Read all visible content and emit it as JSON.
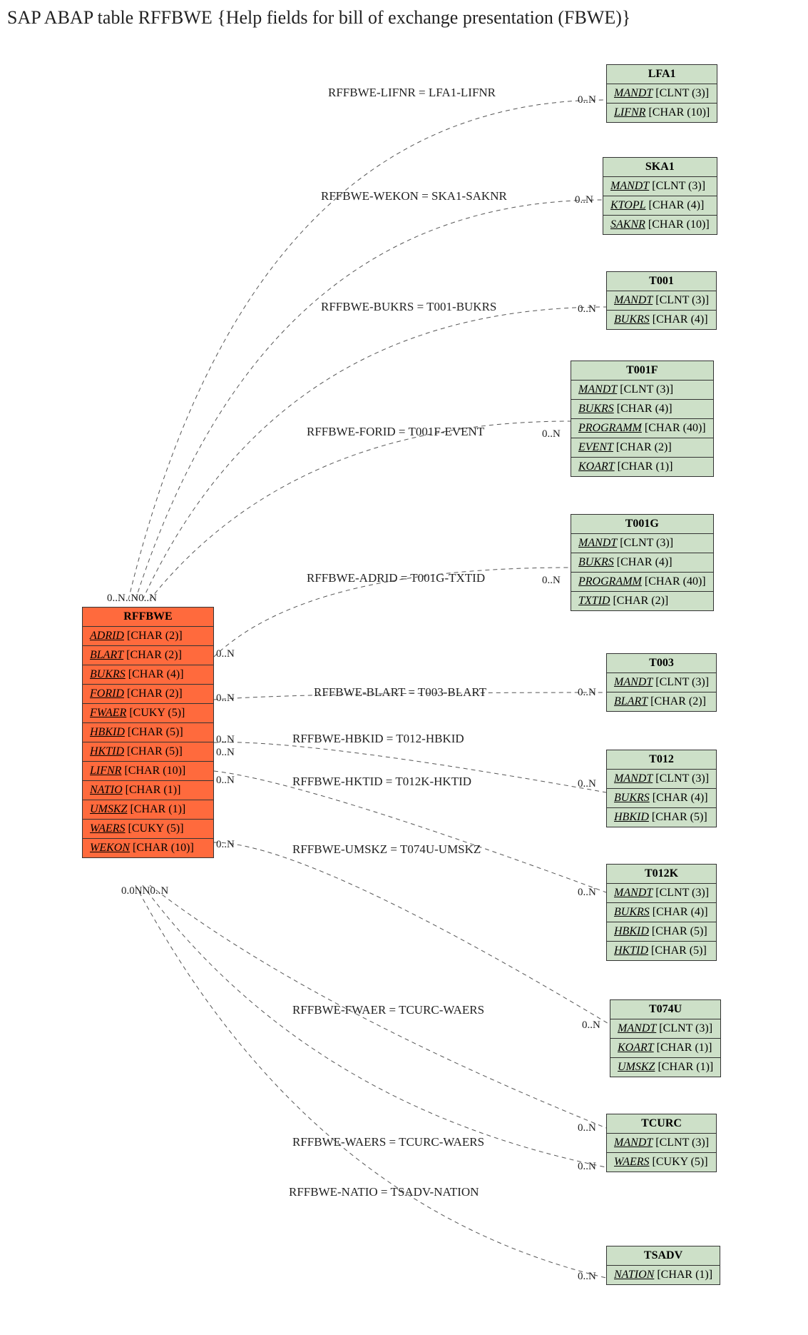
{
  "title": "SAP ABAP table RFFBWE {Help fields for bill of exchange presentation (FBWE)}",
  "main_entity": {
    "name": "RFFBWE",
    "fields": [
      {
        "name": "ADRID",
        "type": "[CHAR (2)]"
      },
      {
        "name": "BLART",
        "type": "[CHAR (2)]"
      },
      {
        "name": "BUKRS",
        "type": "[CHAR (4)]"
      },
      {
        "name": "FORID",
        "type": "[CHAR (2)]"
      },
      {
        "name": "FWAER",
        "type": "[CUKY (5)]"
      },
      {
        "name": "HBKID",
        "type": "[CHAR (5)]"
      },
      {
        "name": "HKTID",
        "type": "[CHAR (5)]"
      },
      {
        "name": "LIFNR",
        "type": "[CHAR (10)]"
      },
      {
        "name": "NATIO",
        "type": "[CHAR (1)]"
      },
      {
        "name": "UMSKZ",
        "type": "[CHAR (1)]"
      },
      {
        "name": "WAERS",
        "type": "[CUKY (5)]"
      },
      {
        "name": "WEKON",
        "type": "[CHAR (10)]"
      }
    ]
  },
  "ref_entities": [
    {
      "name": "LFA1",
      "fields": [
        {
          "name": "MANDT",
          "type": "[CLNT (3)]"
        },
        {
          "name": "LIFNR",
          "type": "[CHAR (10)]"
        }
      ]
    },
    {
      "name": "SKA1",
      "fields": [
        {
          "name": "MANDT",
          "type": "[CLNT (3)]"
        },
        {
          "name": "KTOPL",
          "type": "[CHAR (4)]"
        },
        {
          "name": "SAKNR",
          "type": "[CHAR (10)]"
        }
      ]
    },
    {
      "name": "T001",
      "fields": [
        {
          "name": "MANDT",
          "type": "[CLNT (3)]"
        },
        {
          "name": "BUKRS",
          "type": "[CHAR (4)]"
        }
      ]
    },
    {
      "name": "T001F",
      "fields": [
        {
          "name": "MANDT",
          "type": "[CLNT (3)]"
        },
        {
          "name": "BUKRS",
          "type": "[CHAR (4)]"
        },
        {
          "name": "PROGRAMM",
          "type": "[CHAR (40)]"
        },
        {
          "name": "EVENT",
          "type": "[CHAR (2)]"
        },
        {
          "name": "KOART",
          "type": "[CHAR (1)]"
        }
      ]
    },
    {
      "name": "T001G",
      "fields": [
        {
          "name": "MANDT",
          "type": "[CLNT (3)]"
        },
        {
          "name": "BUKRS",
          "type": "[CHAR (4)]"
        },
        {
          "name": "PROGRAMM",
          "type": "[CHAR (40)]"
        },
        {
          "name": "TXTID",
          "type": "[CHAR (2)]"
        }
      ]
    },
    {
      "name": "T003",
      "fields": [
        {
          "name": "MANDT",
          "type": "[CLNT (3)]"
        },
        {
          "name": "BLART",
          "type": "[CHAR (2)]"
        }
      ]
    },
    {
      "name": "T012",
      "fields": [
        {
          "name": "MANDT",
          "type": "[CLNT (3)]"
        },
        {
          "name": "BUKRS",
          "type": "[CHAR (4)]"
        },
        {
          "name": "HBKID",
          "type": "[CHAR (5)]"
        }
      ]
    },
    {
      "name": "T012K",
      "fields": [
        {
          "name": "MANDT",
          "type": "[CLNT (3)]"
        },
        {
          "name": "BUKRS",
          "type": "[CHAR (4)]"
        },
        {
          "name": "HBKID",
          "type": "[CHAR (5)]"
        },
        {
          "name": "HKTID",
          "type": "[CHAR (5)]"
        }
      ]
    },
    {
      "name": "T074U",
      "fields": [
        {
          "name": "MANDT",
          "type": "[CLNT (3)]"
        },
        {
          "name": "KOART",
          "type": "[CHAR (1)]"
        },
        {
          "name": "UMSKZ",
          "type": "[CHAR (1)]"
        }
      ]
    },
    {
      "name": "TCURC",
      "fields": [
        {
          "name": "MANDT",
          "type": "[CLNT (3)]"
        },
        {
          "name": "WAERS",
          "type": "[CUKY (5)]"
        }
      ]
    },
    {
      "name": "TSADV",
      "fields": [
        {
          "name": "NATION",
          "type": "[CHAR (1)]"
        }
      ]
    }
  ],
  "relations": [
    {
      "label": "RFFBWE-LIFNR = LFA1-LIFNR"
    },
    {
      "label": "RFFBWE-WEKON = SKA1-SAKNR"
    },
    {
      "label": "RFFBWE-BUKRS = T001-BUKRS"
    },
    {
      "label": "RFFBWE-FORID = T001F-EVENT"
    },
    {
      "label": "RFFBWE-ADRID = T001G-TXTID"
    },
    {
      "label": "RFFBWE-BLART = T003-BLART"
    },
    {
      "label": "RFFBWE-HBKID = T012-HBKID"
    },
    {
      "label": "RFFBWE-HKTID = T012K-HKTID"
    },
    {
      "label": "RFFBWE-UMSKZ = T074U-UMSKZ"
    },
    {
      "label": "RFFBWE-FWAER = TCURC-WAERS"
    },
    {
      "label": "RFFBWE-WAERS = TCURC-WAERS"
    },
    {
      "label": "RFFBWE-NATIO = TSADV-NATION"
    }
  ],
  "cardinality": "0..N",
  "left_card_cluster_top": "0..N..N0..N",
  "left_card_cluster_bot": "0.0NN0..N"
}
